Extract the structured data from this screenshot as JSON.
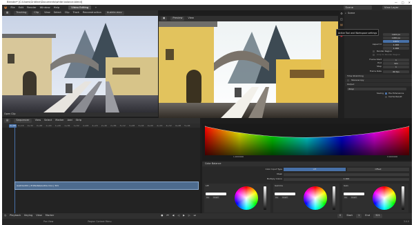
{
  "app": {
    "title": "Blender* [C:\\Users\\Gridline\\Documents\\white balance.blend]",
    "window_buttons": [
      "—",
      "□",
      "✕"
    ]
  },
  "menubar": {
    "logo": "◒",
    "items": [
      "File",
      "Edit",
      "Render",
      "Window",
      "Help"
    ],
    "workspace_tab": "Video Editing",
    "scene_label": "Scene",
    "view_layer_label": "View Layer"
  },
  "clip_editor": {
    "mode": "Tracking",
    "view": "Clip",
    "menus": [
      "View",
      "Select",
      "Clip",
      "Track",
      "Reconstruction"
    ],
    "clip_name": "Austria.mov",
    "open_clip_label": "Open Clip"
  },
  "preview": {
    "mode": "Preview",
    "view": "View"
  },
  "properties": {
    "tooltip": "Active Tool and Workspace settings",
    "breadcrumb": "Scene",
    "resolution_x": "1920 px",
    "resolution_y": "1080 px",
    "percent": "100%",
    "aspect_x": "1.000",
    "aspect_y": "1.000",
    "aspect_label": "Aspect X",
    "render_region_label": "Render Region",
    "crop_label": "Crop to Render Region",
    "frame_start_label": "Frame Start",
    "frame_start": "1",
    "end_label": "End",
    "end": "321",
    "step_label": "Step",
    "step": "1",
    "frame_rate_label": "Frame Rate",
    "frame_rate": "60 fps",
    "time_stretching": "Time Stretching",
    "stereoscopy": "Stereoscopy",
    "output": "Output",
    "output_path": "/tmp\\",
    "saving_label": "Saving",
    "file_extensions": "File Extensions",
    "cache_result": "Cache Result"
  },
  "sequencer": {
    "mode": "Sequencer",
    "menus": [
      "View",
      "Select",
      "Marker",
      "Add",
      "Strip"
    ],
    "current_frame": "0+00",
    "ticks": [
      "0+16",
      "0+32",
      "0+48",
      "1+04",
      "1+20",
      "1+36",
      "1+52",
      "2+08",
      "2+24",
      "2+40",
      "2+56",
      "3+12",
      "3+28",
      "3+44",
      "4+00",
      "4+16",
      "4+32",
      "4+48",
      "5+04"
    ],
    "strip_label": "Austria.001 | Z:\\Media\\Austria.mov | 321"
  },
  "scope": {
    "left_tick": "1.0000000",
    "right_tick": "0.0000000"
  },
  "color_balance": {
    "title": "Color Balance",
    "input_type_label": "Color Input Type",
    "input_type_options": [
      "Lift",
      "Offset"
    ],
    "mask_label": "Mask",
    "multiply_label": "Multiply Colors",
    "multiply_value": "1.000",
    "wheels": [
      {
        "name": "Lift",
        "btn1": "Inv",
        "btn2": "Invert"
      },
      {
        "name": "Gamma",
        "btn1": "Inv",
        "btn2": "Invert"
      },
      {
        "name": "Gain",
        "btn1": "Inv",
        "btn2": "Invert"
      }
    ]
  },
  "timeline": {
    "playback": "Playback",
    "keying": "Keying",
    "view": "View",
    "marker": "Marker",
    "frame": "0",
    "start": "Start",
    "start_val": "1",
    "end": "End",
    "end_val": "321"
  },
  "status": {
    "left": "Pan View",
    "middle": "Region Context Menu",
    "right": "3.0.0"
  }
}
